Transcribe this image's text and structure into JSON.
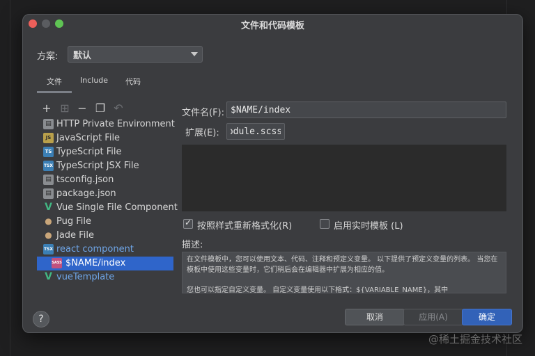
{
  "dialog": {
    "title": "文件和代码模板"
  },
  "scheme": {
    "label": "方案:",
    "value": "默认"
  },
  "tabs": [
    {
      "label": "文件"
    },
    {
      "label": "Include"
    },
    {
      "label": "代码"
    }
  ],
  "toolbar": [
    {
      "icon": "plus-icon",
      "glyph": "+"
    },
    {
      "icon": "copy-child-icon",
      "glyph": "⊞"
    },
    {
      "icon": "minus-icon",
      "glyph": "−"
    },
    {
      "icon": "duplicate-icon",
      "glyph": "❐"
    },
    {
      "icon": "revert-icon",
      "glyph": "↶"
    }
  ],
  "templates": [
    {
      "label": "HTTP Private Environment",
      "icon": "file-icon"
    },
    {
      "label": "JavaScript File",
      "icon": "js-file-icon"
    },
    {
      "label": "TypeScript File",
      "icon": "ts-file-icon"
    },
    {
      "label": "TypeScript JSX File",
      "icon": "tsx-file-icon"
    },
    {
      "label": "tsconfig.json",
      "icon": "file-icon"
    },
    {
      "label": "package.json",
      "icon": "file-icon"
    },
    {
      "label": "Vue Single File Component",
      "icon": "vue-icon"
    },
    {
      "label": "Pug File",
      "icon": "pug-icon"
    },
    {
      "label": "Jade File",
      "icon": "pug-icon"
    },
    {
      "label": "react component",
      "icon": "tsx-file-icon"
    },
    {
      "label": "$NAME/index",
      "icon": "sass-file-icon",
      "selected": true
    },
    {
      "label": "vueTemplate",
      "icon": "vue-icon"
    }
  ],
  "form": {
    "filename_label": "文件名(F):",
    "filename_value": "$NAME/index",
    "ext_label": "扩展(E):",
    "ext_value": "module.scss",
    "reformat_label": "按照样式重新格式化(R)",
    "reformat_checked": true,
    "live_template_label": "启用实时模板 (L)",
    "live_template_checked": false,
    "desc_label": "描述:"
  },
  "description": {
    "para1": "在文件模板中，您可以使用文本、代码、注释和预定义变量。 以下提供了预定义变量的列表。 当您在模板中使用这些变量时，它们稍后会在编辑器中扩展为相应的值。",
    "para2": "您也可以指定自定义变量。 自定义变量使用以下格式：${VARIABLE_NAME}，其中"
  },
  "buttons": {
    "help": "?",
    "cancel": "取消",
    "apply": "应用(A)",
    "ok": "确定"
  },
  "watermark": "@稀土掘金技术社区"
}
